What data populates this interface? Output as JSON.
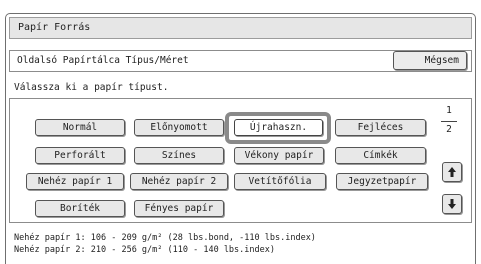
{
  "window": {
    "title": "Papír Forrás"
  },
  "header": {
    "title": "Oldalsó Papírtálca Típus/Méret",
    "cancel_label": "Mégsem"
  },
  "instruction": "Válassza ki a papír típust.",
  "paper_types": [
    {
      "label": "Normál"
    },
    {
      "label": "Előnyomott"
    },
    {
      "label": "Újrahaszn.",
      "selected": true
    },
    {
      "label": "Fejléces"
    },
    {
      "label": "Perforált"
    },
    {
      "label": "Színes"
    },
    {
      "label": "Vékony papír"
    },
    {
      "label": "Címkék"
    },
    {
      "label": "Nehéz papír 1"
    },
    {
      "label": "Nehéz papír 2"
    },
    {
      "label": "Vetítőfólia"
    },
    {
      "label": "Jegyzetpapír"
    },
    {
      "label": "Boríték"
    },
    {
      "label": "Fényes papír"
    }
  ],
  "pagination": {
    "current": "1",
    "total": "2"
  },
  "nav": {
    "up_icon": "arrow-up-icon",
    "down_icon": "arrow-down-icon"
  },
  "footnotes": [
    "Nehéz papír 1: 106 - 209 g/m² (28 lbs.bond, -110 lbs.index)",
    "Nehéz papír 2: 210 - 256 g/m² (110 - 140 lbs.index)"
  ]
}
